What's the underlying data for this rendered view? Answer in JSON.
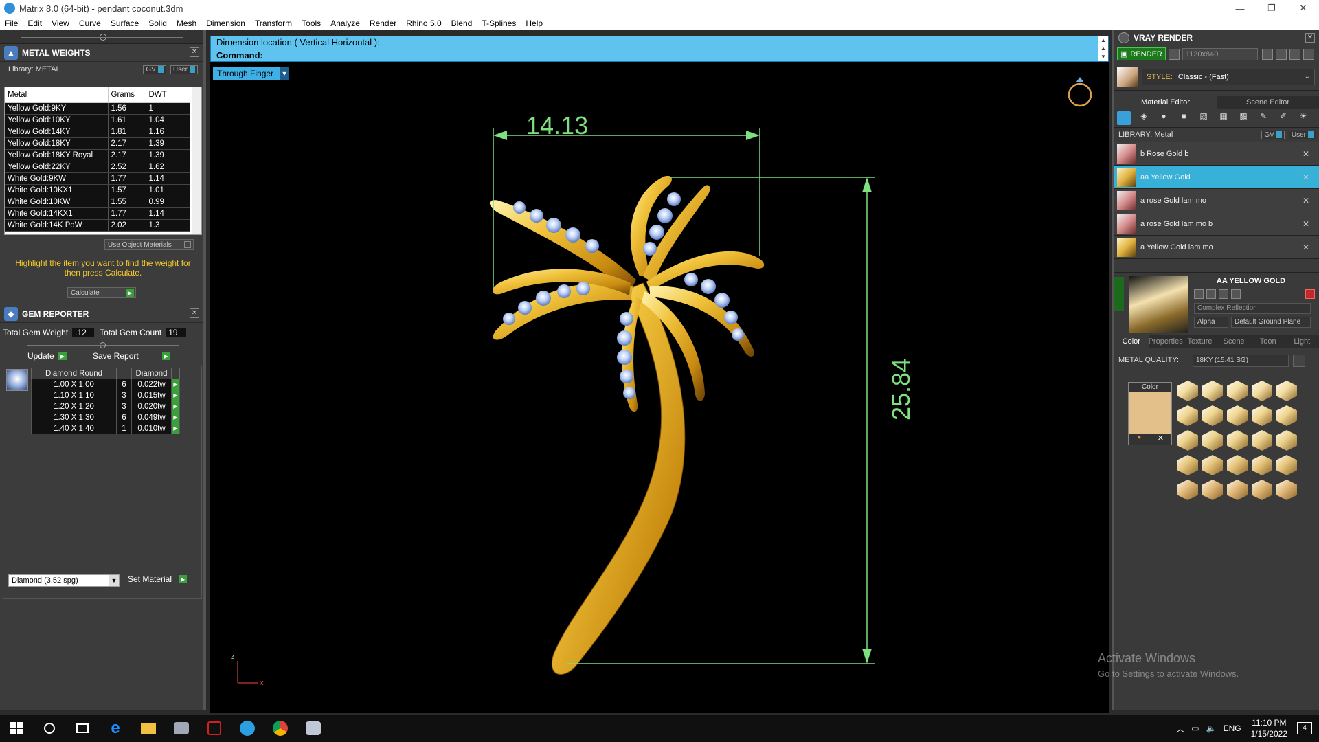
{
  "window": {
    "title": "Matrix 8.0 (64-bit) - pendant coconut.3dm",
    "minimize": "—",
    "maximize": "❐",
    "close": "✕"
  },
  "menu": [
    "File",
    "Edit",
    "View",
    "Curve",
    "Surface",
    "Solid",
    "Mesh",
    "Dimension",
    "Transform",
    "Tools",
    "Analyze",
    "Render",
    "Rhino 5.0",
    "Blend",
    "T-Splines",
    "Help"
  ],
  "metal_weights": {
    "title": "METAL WEIGHTS",
    "library": "Library: METAL",
    "gv": "GV",
    "user": "User",
    "columns": [
      "Metal",
      "Grams",
      "DWT"
    ],
    "rows": [
      [
        "Yellow Gold:9KY",
        "1.56",
        "1"
      ],
      [
        "Yellow Gold:10KY",
        "1.61",
        "1.04"
      ],
      [
        "Yellow Gold:14KY",
        "1.81",
        "1.16"
      ],
      [
        "Yellow Gold:18KY",
        "2.17",
        "1.39"
      ],
      [
        "Yellow Gold:18KY Royal",
        "2.17",
        "1.39"
      ],
      [
        "Yellow Gold:22KY",
        "2.52",
        "1.62"
      ],
      [
        "White Gold:9KW",
        "1.77",
        "1.14"
      ],
      [
        "White Gold:10KX1",
        "1.57",
        "1.01"
      ],
      [
        "White Gold:10KW",
        "1.55",
        "0.99"
      ],
      [
        "White Gold:14KX1",
        "1.77",
        "1.14"
      ],
      [
        "White Gold:14K PdW",
        "2.02",
        "1.3"
      ]
    ],
    "use_object_materials": "Use Object Materials",
    "hint": "Highlight the item you want to find the weight for then press Calculate.",
    "calculate": "Calculate"
  },
  "gem_reporter": {
    "title": "GEM REPORTER",
    "total_gem_weight_label": "Total Gem Weight",
    "total_gem_weight": ".12",
    "total_gem_count_label": "Total Gem Count",
    "total_gem_count": "19",
    "update": "Update",
    "save_report": "Save Report",
    "columns": [
      "Diamond Round",
      "Diamond"
    ],
    "rows": [
      [
        "1.00 X 1.00",
        "6",
        "0.022tw"
      ],
      [
        "1.10 X 1.10",
        "3",
        "0.015tw"
      ],
      [
        "1.20 X 1.20",
        "3",
        "0.020tw"
      ],
      [
        "1.30 X 1.30",
        "6",
        "0.049tw"
      ],
      [
        "1.40 X 1.40",
        "1",
        "0.010tw"
      ]
    ],
    "material_select": "Diamond    (3.52 spg)",
    "set_material": "Set Material"
  },
  "command": {
    "line1": "Dimension location ( Vertical  Horizontal ):",
    "line2": "Command:"
  },
  "viewport": {
    "label": "Through Finger",
    "dim_width": "14.13",
    "dim_height": "25.84",
    "axis_z": "z",
    "axis_x": "x",
    "gold_color": "#e8b020",
    "dim_color": "#7ee07e"
  },
  "vray": {
    "title": "VRAY RENDER",
    "render_btn": "RENDER",
    "resolution": "1120x840",
    "style_label": "STYLE:",
    "style_value": "Classic - (Fast)",
    "tabs": [
      "Material Editor",
      "Scene Editor"
    ],
    "library": "LIBRARY: Metal",
    "gv": "GV",
    "user": "User",
    "materials": [
      {
        "name": "b Rose Gold b",
        "selected": false,
        "tone": "rose"
      },
      {
        "name": "aa Yellow Gold",
        "selected": true,
        "tone": "gold"
      },
      {
        "name": "a rose Gold lam mo",
        "selected": false,
        "tone": "rose"
      },
      {
        "name": "a rose Gold lam mo b",
        "selected": false,
        "tone": "rose"
      },
      {
        "name": "a Yellow Gold lam mo",
        "selected": false,
        "tone": "gold"
      }
    ],
    "preview_title": "AA YELLOW GOLD",
    "reflection": "Complex Reflection",
    "alpha": "Alpha",
    "ground": "Default Ground Plane",
    "sub_tabs": [
      "Color",
      "Properties",
      "Texture",
      "Scene",
      "Toon",
      "Light"
    ],
    "metal_quality_label": "METAL QUALITY:",
    "metal_quality_value": "18KY        (15.41 SG)",
    "color_label": "Color",
    "color_swatch": "#e3bf8a"
  },
  "watermark": {
    "line1": "Activate Windows",
    "line2": "Go to Settings to activate Windows."
  },
  "taskbar": {
    "time": "11:10 PM",
    "date": "1/15/2022",
    "lang": "ENG",
    "notif": "4"
  }
}
